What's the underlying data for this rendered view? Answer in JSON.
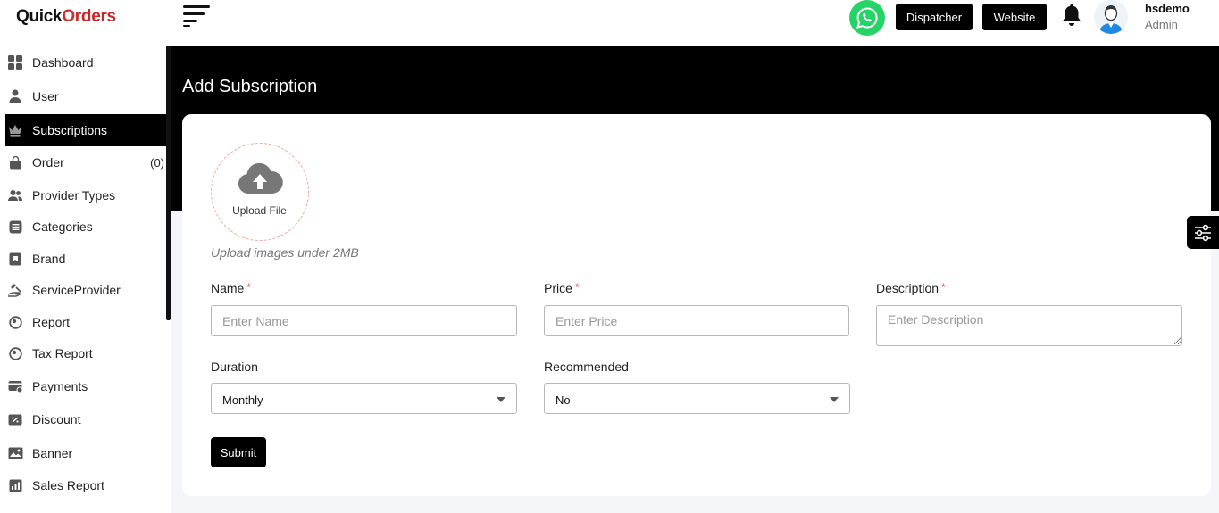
{
  "brand": {
    "part1": "Quick",
    "o": "O",
    "part2": "rders"
  },
  "sidebar": {
    "items": [
      {
        "label": "Dashboard",
        "icon": "dashboard-icon"
      },
      {
        "label": "User",
        "icon": "user-icon"
      },
      {
        "label": "Subscriptions",
        "icon": "crown-icon",
        "active": true
      },
      {
        "label": "Order",
        "icon": "bag-icon",
        "count": "(0)"
      },
      {
        "label": "Provider Types",
        "icon": "users-icon"
      },
      {
        "label": "Categories",
        "icon": "categories-icon"
      },
      {
        "label": "Brand",
        "icon": "brand-icon"
      },
      {
        "label": "ServiceProvider",
        "icon": "service-provider-icon"
      },
      {
        "label": "Report",
        "icon": "report-icon"
      },
      {
        "label": "Tax Report",
        "icon": "tax-report-icon"
      },
      {
        "label": "Payments",
        "icon": "payments-icon"
      },
      {
        "label": "Discount",
        "icon": "discount-icon"
      },
      {
        "label": "Banner",
        "icon": "banner-icon"
      },
      {
        "label": "Sales Report",
        "icon": "sales-report-icon"
      }
    ]
  },
  "header": {
    "dispatcher_label": "Dispatcher",
    "website_label": "Website",
    "user_name": "hsdemo",
    "user_role": "Admin"
  },
  "page": {
    "title": "Add Subscription",
    "upload_label": "Upload File",
    "upload_hint": "Upload images under 2MB",
    "form": {
      "name_label": "Name",
      "name_placeholder": "Enter Name",
      "price_label": "Price",
      "price_placeholder": "Enter Price",
      "description_label": "Description",
      "description_placeholder": "Enter Description",
      "required_mark": "*",
      "duration_label": "Duration",
      "duration_value": "Monthly",
      "recommended_label": "Recommended",
      "recommended_value": "No",
      "submit_label": "Submit"
    }
  },
  "colors": {
    "accent": "#000000",
    "whatsapp": "#25d366",
    "required": "#e53935",
    "brand_red": "#c62828"
  }
}
